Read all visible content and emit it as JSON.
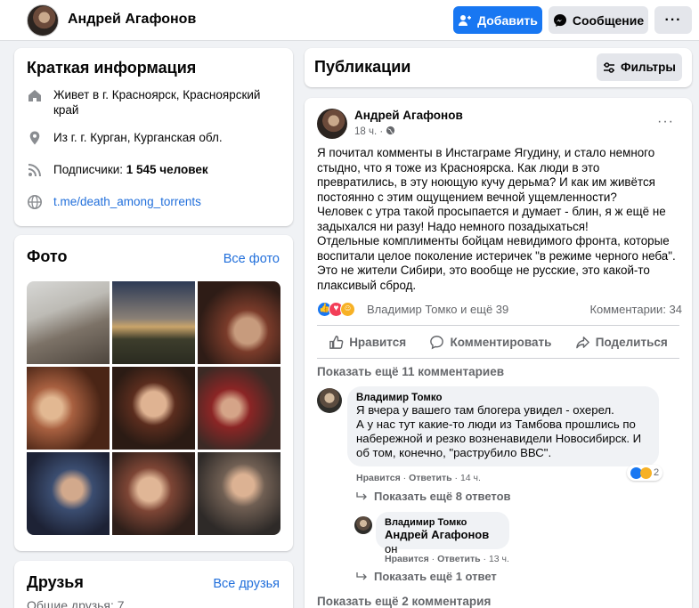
{
  "topbar": {
    "name": "Андрей Агафонов",
    "add_label": "Добавить",
    "message_label": "Сообщение",
    "more_label": "···"
  },
  "intro": {
    "title": "Краткая информация",
    "lives_in": "Живет в г. Красноярск, Красноярский край",
    "from": "Из г. г. Курган, Курганская обл.",
    "followers_prefix": "Подписчики: ",
    "followers_count": "1 545 человек",
    "link": "t.me/death_among_torrents"
  },
  "photos": {
    "title": "Фото",
    "all_label": "Все фото"
  },
  "friends": {
    "title": "Друзья",
    "all_label": "Все друзья",
    "mutual": "Общие друзья: 7"
  },
  "publications": {
    "title": "Публикации",
    "filters_label": "Фильтры"
  },
  "post": {
    "author": "Андрей Агафонов",
    "time": "18 ч.",
    "dot": "·",
    "more_label": "···",
    "paragraphs": [
      "Я почитал комменты в Инстаграме Ягудину, и стало немного стыдно, что я тоже из Красноярска. Как люди в это превратились, в эту ноющую кучу дерьма? И как им живётся постоянно с этим ощущением вечной ущемленности?",
      "Человек с утра такой просыпается и думает - блин, я ж ещё не задыхался ни разу! Надо немного позадыхаться!",
      "Отдельные комплименты бойцам невидимого фронта, которые воспитали целое поколение истеричек \"в режиме черного неба\". Это не жители Сибири, это вообще не русские, это какой-то плаксивый сброд."
    ],
    "reactions_names": "Владимир Томко и ещё 39",
    "comments_count": "Комментарии: 34",
    "like_label": "Нравится",
    "comment_label": "Комментировать",
    "share_label": "Поделиться",
    "show_more_comments": "Показать ещё 11 комментариев",
    "show_more_comments_bottom": "Показать ещё 2 комментария"
  },
  "comment1": {
    "author": "Владимир Томко",
    "text_lines": [
      "Я вчера у вашего там блогера увидел - охерел.",
      "А у нас тут какие-то люди из Тамбова прошлись по набережной и резко возненавидели Новосибирск. И об том, конечно, \"раструбило ВВС\"."
    ],
    "like": "Нравится",
    "reply": "Ответить",
    "time": "14 ч.",
    "reaction_count": "2",
    "replies_label": "Показать ещё 8 ответов"
  },
  "comment2": {
    "author": "Владимир Томко",
    "mention": "Андрей Агафонов",
    "text_rest": " он",
    "like": "Нравится",
    "reply": "Ответить",
    "time": "13 ч.",
    "replies_label": "Показать ещё 1 ответ"
  },
  "colors": {
    "brand_blue": "#1877f2",
    "link_blue": "#216fdb",
    "secondary_text": "#65676b",
    "page_bg": "#f0f2f5"
  }
}
